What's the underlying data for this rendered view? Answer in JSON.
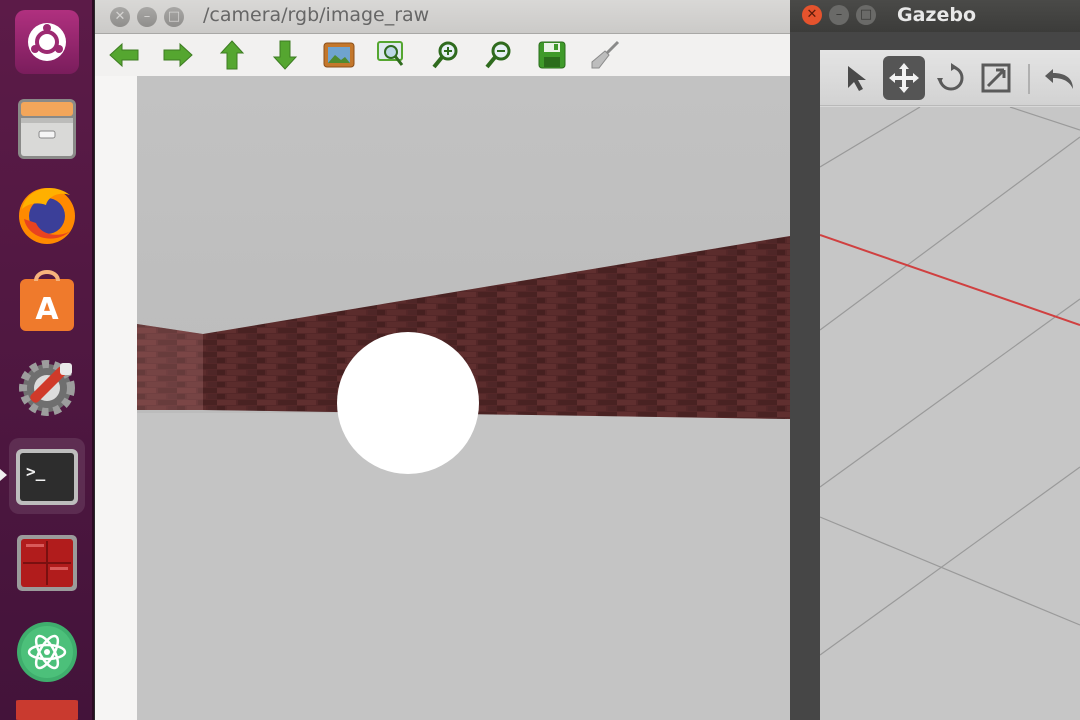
{
  "launcher": {
    "items": [
      {
        "name": "ubuntu-icon",
        "label": "Search your computer"
      },
      {
        "name": "files-icon",
        "label": "Files"
      },
      {
        "name": "firefox-icon",
        "label": "Firefox Web Browser"
      },
      {
        "name": "software-center-icon",
        "label": "Ubuntu Software"
      },
      {
        "name": "system-settings-icon",
        "label": "System Settings"
      },
      {
        "name": "terminal-icon",
        "label": "Terminal"
      },
      {
        "name": "workspace-switcher-icon",
        "label": "Workspace Switcher"
      },
      {
        "name": "atom-icon",
        "label": "Atom"
      }
    ],
    "active_item": "terminal-icon"
  },
  "image_view": {
    "title": "/camera/rgb/image_raw",
    "toolbar": [
      "arrow-left-icon",
      "arrow-right-icon",
      "arrow-up-icon",
      "arrow-down-icon",
      "image-icon",
      "zoom-fit-icon",
      "zoom-in-icon",
      "zoom-out-icon",
      "save-icon",
      "clear-icon"
    ],
    "scene": {
      "description_colors": {
        "floor": "#c3c3c3",
        "sky": "#bdbdbd",
        "wall": "#5a2a2a",
        "ball": "#ffffff"
      }
    }
  },
  "gazebo": {
    "title": "Gazebo",
    "toolbar": [
      "select-arrow-icon",
      "translate-icon",
      "rotate-icon",
      "scale-icon",
      "undo-icon"
    ],
    "selected_tool": "translate-icon"
  },
  "colors": {
    "launcher_bg": "#4e1740",
    "accent_green": "#55a630",
    "titlebar": "#cfcecc",
    "gazebo_dark": "#3c3c3a"
  }
}
